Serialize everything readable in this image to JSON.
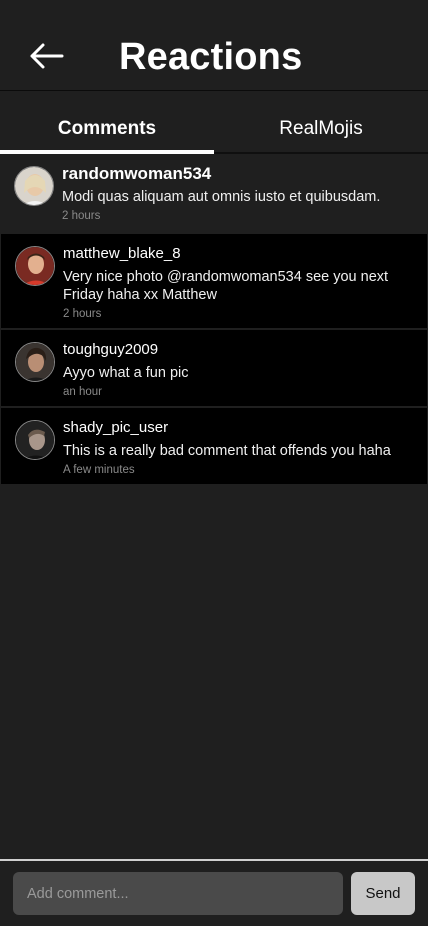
{
  "header": {
    "title": "Reactions",
    "back_icon": "arrow-left-icon"
  },
  "tabs": [
    {
      "label": "Comments",
      "active": true
    },
    {
      "label": "RealMojis",
      "active": false
    }
  ],
  "comments": [
    {
      "user": "randomwoman534",
      "text": "Modi quas aliquam aut omnis iusto et quibusdam.",
      "time": "2 hours"
    },
    {
      "user": "matthew_blake_8",
      "text": "Very nice photo @randomwoman534 see you next Friday haha xx Matthew",
      "time": "2 hours"
    },
    {
      "user": "toughguy2009",
      "text": "Ayyo what a fun pic",
      "time": "an hour"
    },
    {
      "user": "shady_pic_user",
      "text": "This is a really bad comment that offends you haha",
      "time": "A few minutes"
    }
  ],
  "composer": {
    "placeholder": "Add comment...",
    "send_label": "Send"
  },
  "colors": {
    "background": "#1f1f1f",
    "comment_background": "#000000",
    "input_background": "#4a4a4a",
    "send_button": "#c8c8c8"
  }
}
